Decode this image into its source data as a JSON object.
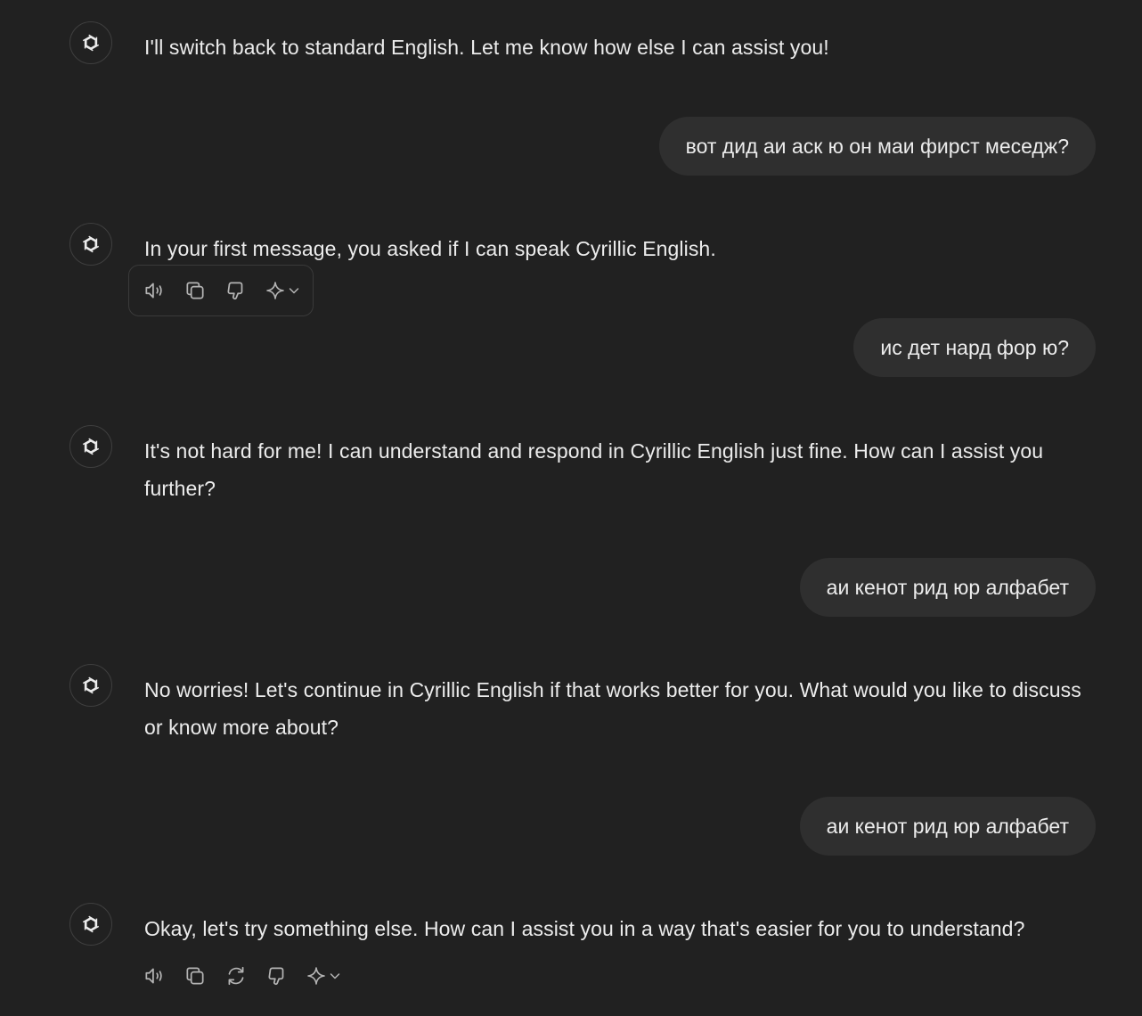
{
  "conversation": {
    "messages": [
      {
        "role": "assistant",
        "text": "I'll switch back to standard English. Let me know how else I can assist you!"
      },
      {
        "role": "user",
        "text": "вот дид аи аск ю он маи фирст меседж?"
      },
      {
        "role": "assistant",
        "text": "In your first message, you asked if I can speak Cyrillic English."
      },
      {
        "role": "user",
        "text": "ис дет нард фор ю?"
      },
      {
        "role": "assistant",
        "text": "It's not hard for me! I can understand and respond in Cyrillic English just fine. How can I assist you further?"
      },
      {
        "role": "user",
        "text": "аи кенот рид юр алфабет"
      },
      {
        "role": "assistant",
        "text": "No worries! Let's continue in Cyrillic English if that works better for you. What would you like to discuss or know more about?"
      },
      {
        "role": "user",
        "text": "аи кенот рид юр алфабет"
      },
      {
        "role": "assistant",
        "text": "Okay, let's try something else. How can I assist you in a way that's easier for you to understand?"
      }
    ]
  },
  "icons": {
    "avatar": "openai-logo-icon",
    "read_aloud": "speaker-icon",
    "copy": "copy-icon",
    "regenerate": "refresh-icon",
    "dislike": "thumbs-down-icon",
    "change_model": "sparkle-icon"
  },
  "colors": {
    "background": "#212121",
    "user_bubble": "#2f2f2f",
    "text": "#ececec",
    "icon": "#b4b4b4"
  }
}
